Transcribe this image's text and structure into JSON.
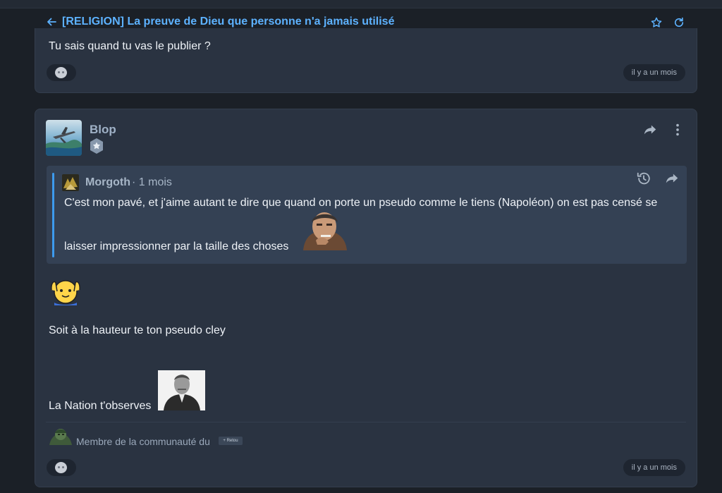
{
  "topic": {
    "title": "[RELIGION] La preuve de Dieu que personne n'a jamais utilisé",
    "back_icon": "arrow-left-icon",
    "favorite_icon": "star-outline-icon",
    "refresh_icon": "refresh-icon"
  },
  "posts": [
    {
      "body": "Tu sais quand tu vas le publier ?",
      "reaction_icon": "emoji-face-icon",
      "time": "il y a un mois"
    },
    {
      "author": "Blop",
      "quote": {
        "author": "Morgoth",
        "time": "· 1 mois",
        "line1": "C'est mon pavé, et j'aime autant te dire que quand on porte un pseudo comme le tiens (Napoléon) on est pas censé se",
        "line2": "laisser impressionner par la taille des choses"
      },
      "body_line1": "Soit à la hauteur te ton pseudo cley",
      "body_line2": "La Nation t'observes",
      "signature": "Membre de la communauté du",
      "signature_tag": "+ Retou",
      "time": "il y a un mois",
      "reaction_icon": "emoji-face-icon"
    }
  ],
  "colors": {
    "accent": "#5db2ff",
    "background": "#1b2027",
    "card": "#2a3341",
    "quote": "#344154"
  }
}
